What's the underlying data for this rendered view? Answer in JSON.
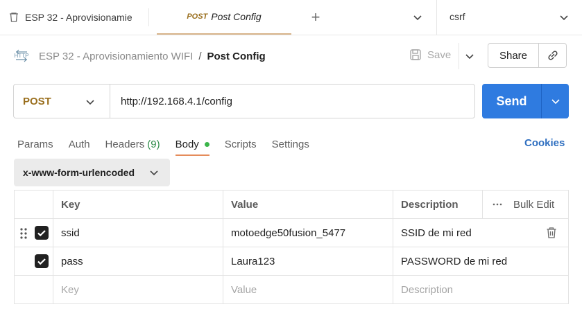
{
  "tabs": {
    "collection_tab": "ESP 32 - Aprovisionamie",
    "active_tab": {
      "method": "POST",
      "title": "Post Config"
    },
    "environment": "csrf"
  },
  "breadcrumb": {
    "collection": "ESP 32 - Aprovisionamiento WIFI",
    "separator": "/",
    "request": "Post Config"
  },
  "toolbar": {
    "save_label": "Save",
    "share_label": "Share"
  },
  "request": {
    "method": "POST",
    "url": "http://192.168.4.1/config",
    "send_label": "Send"
  },
  "subtabs": {
    "params": "Params",
    "auth": "Auth",
    "headers": "Headers",
    "headers_count": "(9)",
    "body": "Body",
    "scripts": "Scripts",
    "settings": "Settings",
    "cookies": "Cookies"
  },
  "body_type": "x-www-form-urlencoded",
  "table": {
    "headers": {
      "key": "Key",
      "value": "Value",
      "description": "Description",
      "bulk_edit": "Bulk Edit"
    },
    "rows": [
      {
        "key": "ssid",
        "value": "motoedge50fusion_5477",
        "description": "SSID de mi red",
        "checked": true
      },
      {
        "key": "pass",
        "value": "Laura123",
        "description": "PASSWORD de mi red",
        "checked": true
      }
    ],
    "placeholder": {
      "key": "Key",
      "value": "Value",
      "description": "Description"
    }
  },
  "colors": {
    "accent": "#2f7be0",
    "method": "#9a6f1e",
    "dot": "#3bb54a"
  }
}
